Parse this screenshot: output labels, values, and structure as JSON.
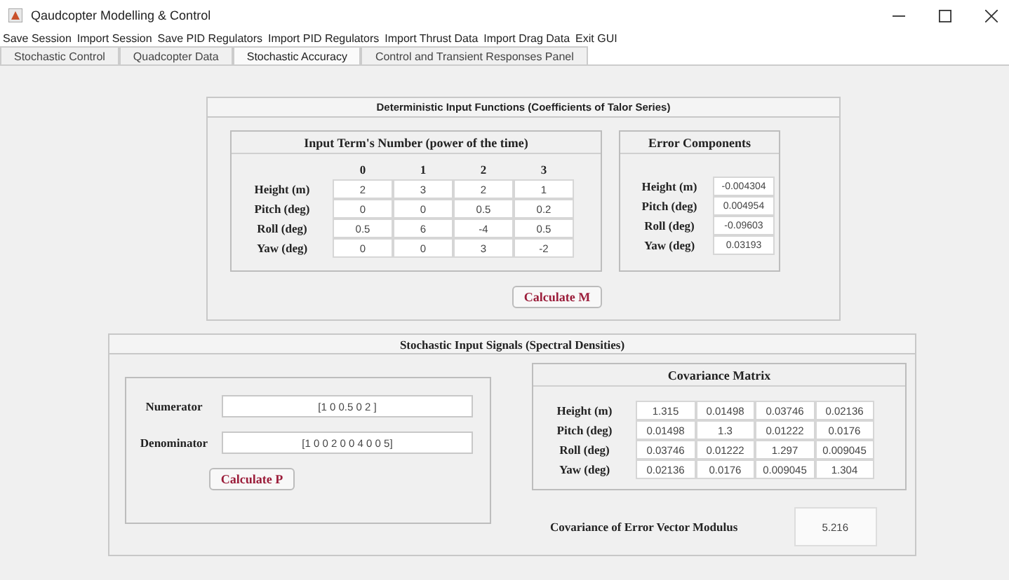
{
  "window": {
    "title": "Qaudcopter Modelling & Control"
  },
  "menu": [
    "Save Session",
    "Import Session",
    "Save PID Regulators",
    "Import PID Regulators",
    "Import Thrust Data",
    "Import Drag Data",
    "Exit GUI"
  ],
  "tabs": [
    {
      "label": "Stochastic Control",
      "selected": false
    },
    {
      "label": "Quadcopter Data",
      "selected": false
    },
    {
      "label": "Stochastic Accuracy",
      "selected": true
    },
    {
      "label": "Control and Transient Responses Panel",
      "selected": false
    }
  ],
  "deterministic": {
    "title": "Deterministic Input Functions (Coefficients of Talor Series)",
    "terms": {
      "title": "Input Term's Number (power of the time)",
      "columns": [
        "0",
        "1",
        "2",
        "3"
      ],
      "rows": [
        {
          "label": "Height (m)",
          "values": [
            "2",
            "3",
            "2",
            "1"
          ]
        },
        {
          "label": "Pitch (deg)",
          "values": [
            "0",
            "0",
            "0.5",
            "0.2"
          ]
        },
        {
          "label": "Roll (deg)",
          "values": [
            "0.5",
            "6",
            "-4",
            "0.5"
          ]
        },
        {
          "label": "Yaw (deg)",
          "values": [
            "0",
            "0",
            "3",
            "-2"
          ]
        }
      ]
    },
    "errors": {
      "title": "Error Components",
      "rows": [
        {
          "label": "Height (m)",
          "value": "-0.004304"
        },
        {
          "label": "Pitch (deg)",
          "value": "0.004954"
        },
        {
          "label": "Roll (deg)",
          "value": "-0.09603"
        },
        {
          "label": "Yaw (deg)",
          "value": "0.03193"
        }
      ]
    },
    "button": "Calculate M"
  },
  "stochastic": {
    "title": "Stochastic Input Signals (Spectral Densities)",
    "numerator": {
      "label": "Numerator",
      "value": "[1 0 0.5 0 2 ]"
    },
    "denominator": {
      "label": "Denominator",
      "value": "[1 0 0 2 0 0 4 0 0 5]"
    },
    "button": "Calculate P",
    "covariance": {
      "title": "Covariance Matrix",
      "rows": [
        {
          "label": "Height (m)",
          "values": [
            "1.315",
            "0.01498",
            "0.03746",
            "0.02136"
          ]
        },
        {
          "label": "Pitch (deg)",
          "values": [
            "0.01498",
            "1.3",
            "0.01222",
            "0.0176"
          ]
        },
        {
          "label": "Roll (deg)",
          "values": [
            "0.03746",
            "0.01222",
            "1.297",
            "0.009045"
          ]
        },
        {
          "label": "Yaw (deg)",
          "values": [
            "0.02136",
            "0.0176",
            "0.009045",
            "1.304"
          ]
        }
      ]
    },
    "modulus": {
      "label": "Covariance of Error Vector Modulus",
      "value": "5.216"
    }
  }
}
